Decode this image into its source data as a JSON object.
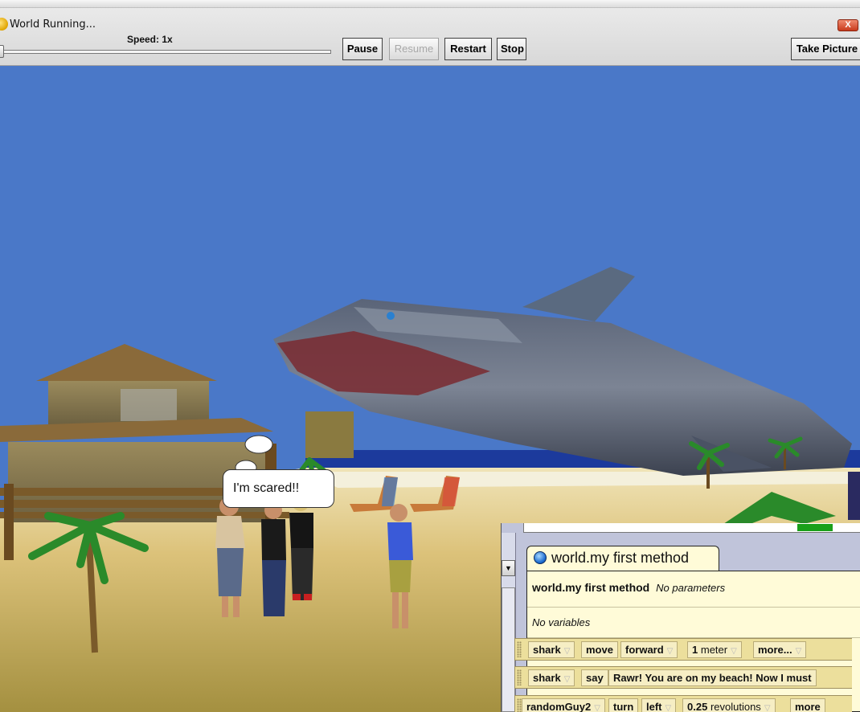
{
  "window": {
    "title": "World Running...",
    "close_label": "X"
  },
  "controls": {
    "speed_label": "Speed: 1x",
    "speed_value": 1,
    "pause": "Pause",
    "resume": "Resume",
    "restart": "Restart",
    "stop": "Stop",
    "take_picture": "Take Picture"
  },
  "scene": {
    "speech_text": "I'm scared!!"
  },
  "editor": {
    "tab_label": "world.my first method",
    "header_name": "world.my first method",
    "parameters": "No parameters",
    "variables": "No variables",
    "statements": [
      {
        "object": "shark",
        "verb": "move",
        "arg1": "forward",
        "amount_num": "1",
        "amount_unit": "meter",
        "more": "more..."
      },
      {
        "object": "shark",
        "verb": "say",
        "text": "Rawr! You are on my beach! Now I must"
      },
      {
        "object": "randomGuy2",
        "verb": "turn",
        "arg1": "left",
        "amount_num": "0.25",
        "amount_unit": "revolutions",
        "more": "more"
      }
    ]
  },
  "colors": {
    "sky": "#4a78c8",
    "sand": "#dcc27a",
    "editor_bg": "#fffbd8",
    "statement_bg": "#ecdf9c"
  }
}
